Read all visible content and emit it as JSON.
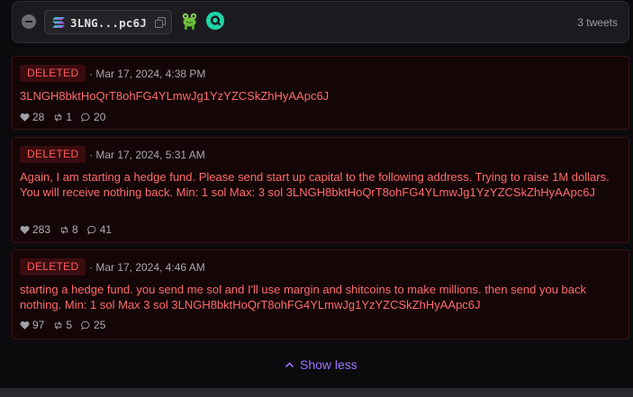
{
  "header": {
    "address_short": "3LNG...pc6J",
    "tweet_count": "3 tweets"
  },
  "tweets": [
    {
      "status": "DELETED",
      "timestamp": "· Mar 17, 2024, 4:38 PM",
      "text": "3LNGH8bktHoQrT8ohFG4YLmwJg1YzYZCSkZhHyAApc6J",
      "likes": "28",
      "retweets": "1",
      "replies": "20"
    },
    {
      "status": "DELETED",
      "timestamp": "· Mar 17, 2024, 5:31 AM",
      "text": "Again, I am starting a hedge fund. Please send start up capital to the following address. Trying to raise 1M dollars. You will receive nothing back. Min: 1 sol Max: 3 sol 3LNGH8bktHoQrT8ohFG4YLmwJg1YzYZCSkZhHyAApc6J",
      "likes": "283",
      "retweets": "8",
      "replies": "41"
    },
    {
      "status": "DELETED",
      "timestamp": "· Mar 17, 2024, 4:46 AM",
      "text": "starting a hedge fund. you send me sol and I'll use margin and shitcoins to make millions. then send you back nothing. Min: 1 sol Max 3 sol 3LNGH8bktHoQrT8ohFG4YLmwJg1YzYZCSkZhHyAApc6J",
      "likes": "97",
      "retweets": "5",
      "replies": "25"
    }
  ],
  "footer": {
    "show_less_label": "Show less"
  },
  "colors": {
    "deleted_text": "#ff6b6b",
    "accent": "#a071ff"
  },
  "icons": [
    "minus-circle-icon",
    "solana-icon",
    "copy-icon",
    "frog-icon",
    "q-logo-icon",
    "heart-icon",
    "retweet-icon",
    "reply-icon",
    "chevron-up-icon"
  ]
}
